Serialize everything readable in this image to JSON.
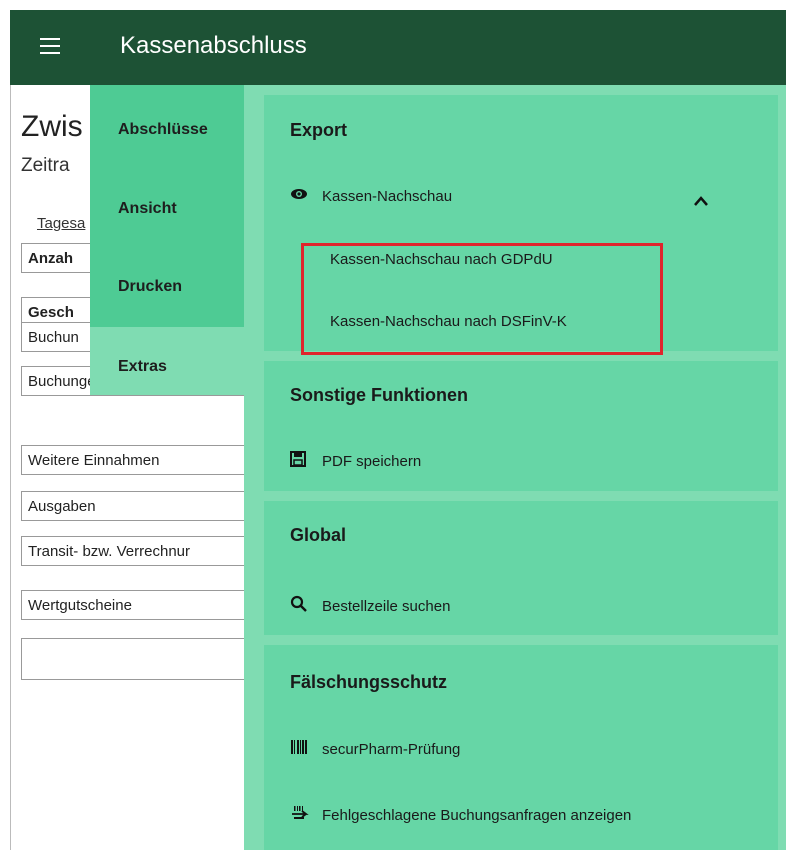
{
  "header": {
    "title": "Kassenabschluss"
  },
  "background": {
    "title": "Zwis",
    "subtitle": "Zeitra",
    "tab": "Tagesa",
    "rows": [
      "Anzah",
      "Gesch",
      "Buchun",
      "Buchungen auf Personen",
      "Weitere Einnahmen",
      "Ausgaben",
      "Transit- bzw. Verrechnur",
      "Wertgutscheine",
      ""
    ]
  },
  "nav": {
    "items": [
      "Abschlüsse",
      "Ansicht",
      "Drucken",
      "Extras"
    ]
  },
  "sections": {
    "export": {
      "title": "Export",
      "item": "Kassen-Nachschau",
      "subitems": [
        "Kassen-Nachschau nach GDPdU",
        "Kassen-Nachschau nach DSFinV-K"
      ]
    },
    "sonstige": {
      "title": "Sonstige Funktionen",
      "item": "PDF speichern"
    },
    "global": {
      "title": "Global",
      "item": "Bestellzeile suchen"
    },
    "faelschung": {
      "title": "Fälschungsschutz",
      "items": [
        "securPharm-Prüfung",
        "Fehlgeschlagene Buchungsanfragen anzeigen"
      ]
    }
  },
  "colors": {
    "header": "#1d5235",
    "nav_active": "#4ecb94",
    "panel": "#7fdcb2",
    "section": "#66d6a6",
    "highlight": "#e0242c"
  },
  "icons": [
    "menu-icon",
    "eye-icon",
    "chevron-up-icon",
    "floppy-disk-icon",
    "search-icon",
    "barcode-icon",
    "scanner-icon"
  ]
}
